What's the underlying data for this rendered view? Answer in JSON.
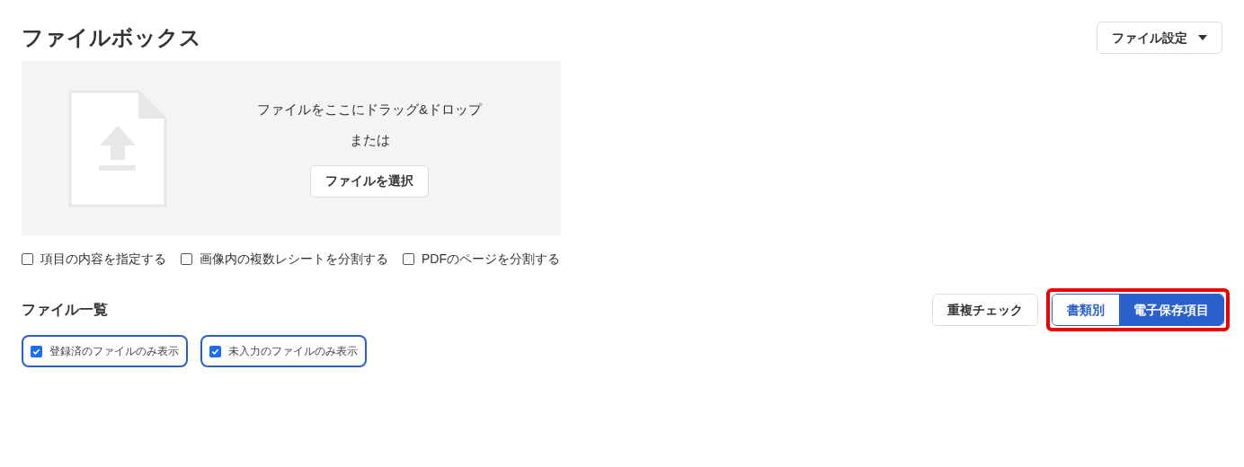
{
  "title": "ファイルボックス",
  "settings_menu": {
    "label": "ファイル設定"
  },
  "dropzone": {
    "message": "ファイルをここにドラッグ&ドロップ",
    "or": "または",
    "button": "ファイルを選択"
  },
  "options": [
    {
      "label": "項目の内容を指定する",
      "checked": false
    },
    {
      "label": "画像内の複数レシートを分割する",
      "checked": false
    },
    {
      "label": "PDFのページを分割する",
      "checked": false
    }
  ],
  "file_list": {
    "heading": "ファイル一覧",
    "duplicate_button": "重複チェック",
    "view_toggle": {
      "highlighted": true,
      "items": [
        {
          "label": "書類別",
          "selected": false
        },
        {
          "label": "電子保存項目",
          "selected": true
        }
      ]
    },
    "filters": [
      {
        "label": "登録済のファイルのみ表示",
        "checked": true
      },
      {
        "label": "未入力のファイルのみ表示",
        "checked": true
      }
    ]
  }
}
